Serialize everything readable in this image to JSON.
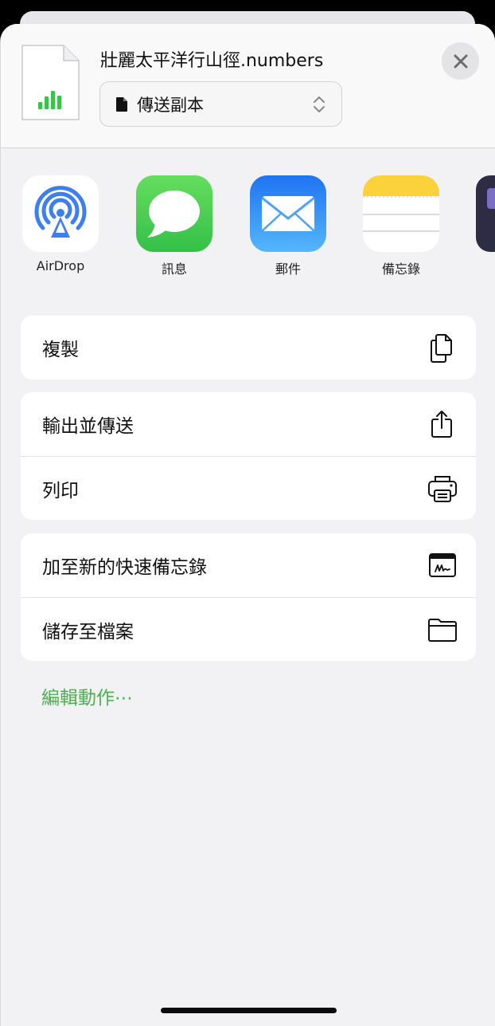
{
  "header": {
    "file_name": "壯麗太平洋行山徑.numbers",
    "send_option": "傳送副本"
  },
  "apps": [
    {
      "label": "AirDrop",
      "icon": "airdrop-icon"
    },
    {
      "label": "訊息",
      "icon": "messages-icon"
    },
    {
      "label": "郵件",
      "icon": "mail-icon"
    },
    {
      "label": "備忘錄",
      "icon": "notes-icon"
    }
  ],
  "actions": {
    "group1": [
      {
        "label": "複製",
        "icon": "copy-icon"
      }
    ],
    "group2": [
      {
        "label": "輸出並傳送",
        "icon": "share-icon"
      },
      {
        "label": "列印",
        "icon": "printer-icon"
      }
    ],
    "group3": [
      {
        "label": "加至新的快速備忘錄",
        "icon": "quick-note-icon"
      },
      {
        "label": "儲存至檔案",
        "icon": "folder-icon"
      }
    ]
  },
  "edit_actions_label": "編輯動作⋯",
  "colors": {
    "accent_green": "#4db04f",
    "airdrop_blue": "#3b7ff0",
    "messages_green": "#4cd964",
    "mail_blue": "#2f8ef8",
    "notes_yellow": "#fbd23c"
  }
}
